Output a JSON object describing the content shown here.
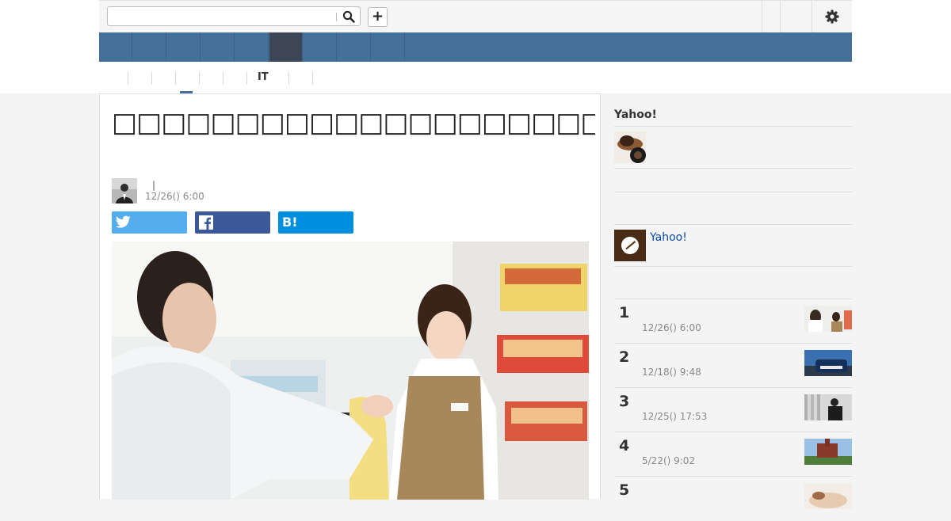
{
  "header": {
    "search_value": "",
    "add_label": "+",
    "nav_tab_count": 9,
    "active_nav_tab": 5,
    "accent_color": "#44709a"
  },
  "categories": {
    "it_label": "IT"
  },
  "article": {
    "headline": "□□□□□□□□□□□□□□□□□□□□□□□□□□□□□□□□□□",
    "author_pipe": "|",
    "date": "12/26() 6:00",
    "share_labels": {
      "twitter": "",
      "facebook": "",
      "hatena": "B!"
    }
  },
  "sidebar": {
    "title": "Yahoo!",
    "link_label": "Yahoo!",
    "ranking": [
      {
        "rank": "1",
        "date": "12/26() 6:00"
      },
      {
        "rank": "2",
        "date": "12/18() 9:48"
      },
      {
        "rank": "3",
        "date": "12/25() 17:53"
      },
      {
        "rank": "4",
        "date": "5/22() 9:02"
      },
      {
        "rank": "5",
        "date": ""
      }
    ]
  },
  "icons": [
    "search-icon",
    "plus-icon",
    "gear-icon",
    "twitter-icon",
    "facebook-icon",
    "hatena-bookmark-icon"
  ]
}
